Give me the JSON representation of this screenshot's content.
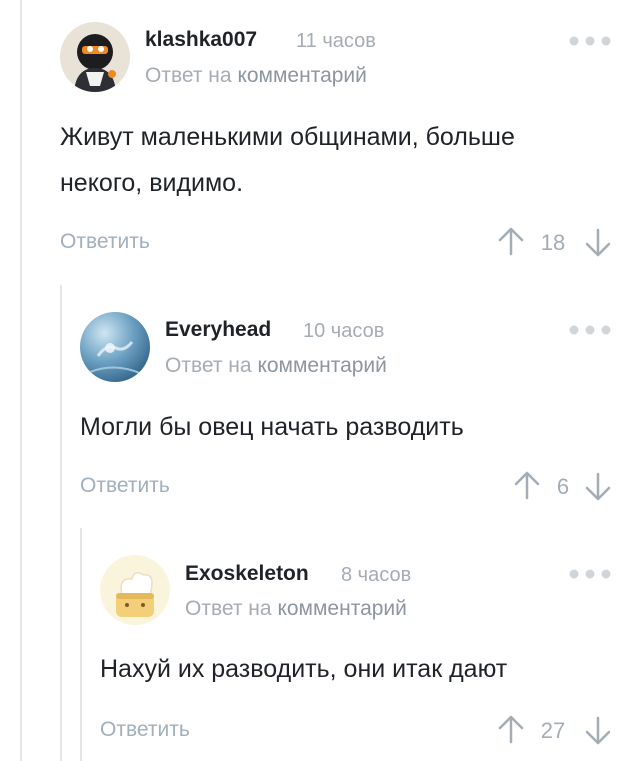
{
  "comments": [
    {
      "author": "klashka007",
      "time": "11 часов",
      "reply_prefix": "Ответ на",
      "reply_link": "комментарий",
      "text": "Живут маленькими общинами, больше некого, видимо.",
      "reply_label": "Ответить",
      "rating": "18",
      "avatar_icon": "penguin-avatar-icon"
    },
    {
      "author": "Everyhead",
      "time": "10 часов",
      "reply_prefix": "Ответ на",
      "reply_link": "комментарий",
      "text": "Могли бы овец начать разводить",
      "reply_label": "Ответить",
      "rating": "6",
      "avatar_icon": "underwater-avatar-icon"
    },
    {
      "author": "Exoskeleton",
      "time": "8 часов",
      "reply_prefix": "Ответ на",
      "reply_link": "комментарий",
      "text": "Нахуй их разводить, они итак дают",
      "reply_label": "Ответить",
      "rating": "27",
      "avatar_icon": "toast-avatar-icon"
    }
  ],
  "colors": {
    "text": "#1f2327",
    "muted": "#a5acb3",
    "action": "#a0b0bd",
    "rail": "#e3e6e9"
  }
}
